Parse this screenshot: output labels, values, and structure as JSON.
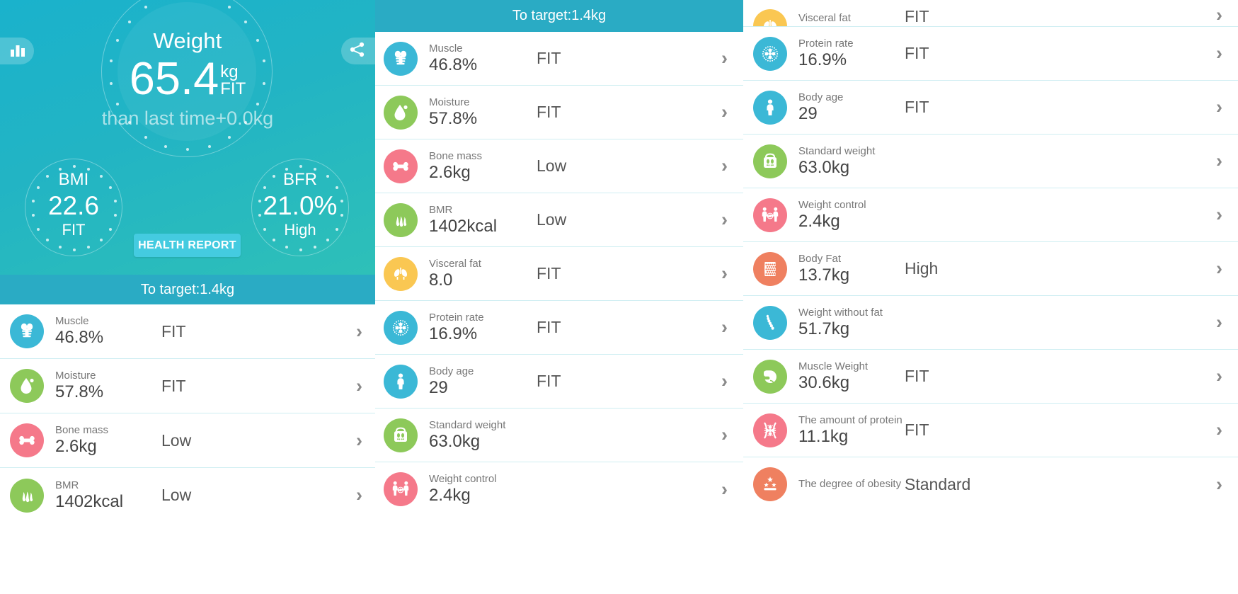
{
  "colors": {
    "teal_header": "#2aabc4",
    "hero_start": "#1ab2cc",
    "hero_end": "#2ec0b8",
    "accent_button": "#44cbe0",
    "blue": "#3bb8d6",
    "green": "#8dc95a",
    "pink": "#f5798a",
    "yellow": "#fac752",
    "salmon": "#ef8060",
    "divider": "#cfeef2"
  },
  "hero": {
    "weight_label": "Weight",
    "weight_value": "65.4",
    "weight_unit": "kg",
    "weight_state": "FIT",
    "weight_sub": "than last time+0.0kg",
    "bmi": {
      "title": "BMI",
      "value": "22.6",
      "state": "FIT"
    },
    "bfr": {
      "title": "BFR",
      "value": "21.0%",
      "state": "High"
    },
    "health_report_label": "HEALTH REPORT",
    "chart_icon": "bar-chart-icon",
    "share_icon": "share-icon"
  },
  "target_bar": {
    "text": "To target:1.4kg"
  },
  "metrics": [
    {
      "icon": "muscle-icon",
      "color": "#3bb8d6",
      "name": "Muscle",
      "value": "46.8%",
      "state": "FIT"
    },
    {
      "icon": "water-drop-icon",
      "color": "#8dc95a",
      "name": "Moisture",
      "value": "57.8%",
      "state": "FIT"
    },
    {
      "icon": "bone-icon",
      "color": "#f5798a",
      "name": "Bone mass",
      "value": "2.6kg",
      "state": "Low"
    },
    {
      "icon": "flame-icon",
      "color": "#8dc95a",
      "name": "BMR",
      "value": "1402kcal",
      "state": "Low"
    },
    {
      "icon": "lungs-icon",
      "color": "#fac752",
      "name": "Visceral fat",
      "value": "8.0",
      "state": "FIT"
    },
    {
      "icon": "protein-cell-icon",
      "color": "#3bb8d6",
      "name": "Protein rate",
      "value": "16.9%",
      "state": "FIT"
    },
    {
      "icon": "person-icon",
      "color": "#3bb8d6",
      "name": "Body age",
      "value": "29",
      "state": "FIT"
    },
    {
      "icon": "scale-icon",
      "color": "#8dc95a",
      "name": "Standard weight",
      "value": "63.0kg",
      "state": ""
    },
    {
      "icon": "two-people-icon",
      "color": "#f5798a",
      "name": "Weight control",
      "value": "2.4kg",
      "state": ""
    },
    {
      "icon": "fat-cells-icon",
      "color": "#ef8060",
      "name": "Body Fat",
      "value": "13.7kg",
      "state": "High"
    },
    {
      "icon": "spine-icon",
      "color": "#3bb8d6",
      "name": "Weight without fat",
      "value": "51.7kg",
      "state": ""
    },
    {
      "icon": "biceps-icon",
      "color": "#8dc95a",
      "name": "Muscle Weight",
      "value": "30.6kg",
      "state": "FIT"
    },
    {
      "icon": "protein-amount-icon",
      "color": "#f5798a",
      "name": "The amount of protein",
      "value": "11.1kg",
      "state": "FIT"
    },
    {
      "icon": "stars-icon",
      "color": "#ef8060",
      "name": "The degree of obesity",
      "value": "",
      "state": "Standard"
    }
  ],
  "panel1": {
    "visible_metric_indexes": [
      0,
      1,
      2,
      3
    ]
  },
  "panel2": {
    "visible_metric_indexes": [
      0,
      1,
      2,
      3,
      4,
      5,
      6,
      7,
      8
    ]
  },
  "panel3": {
    "visible_metric_indexes": [
      4,
      5,
      6,
      7,
      8,
      9,
      10,
      11,
      12,
      13
    ]
  },
  "chevron": "›"
}
